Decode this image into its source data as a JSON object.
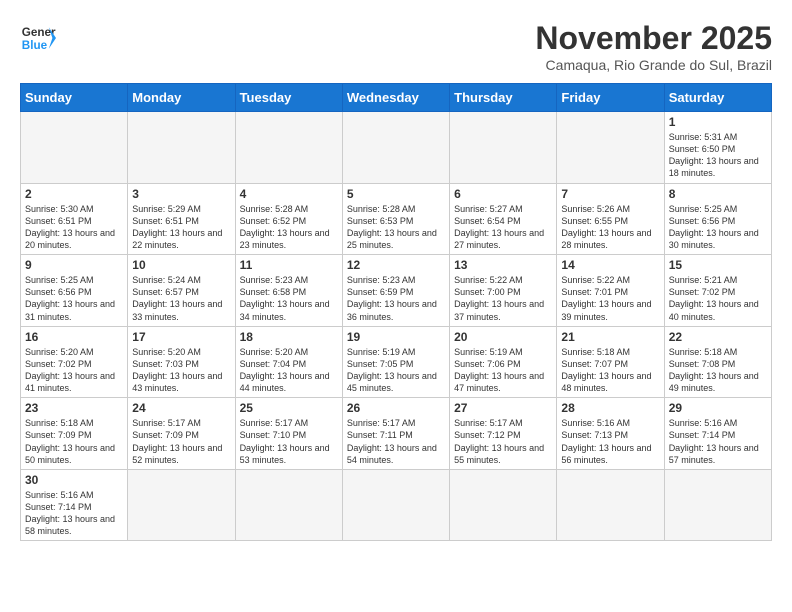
{
  "header": {
    "logo_general": "General",
    "logo_blue": "Blue",
    "month_title": "November 2025",
    "subtitle": "Camaqua, Rio Grande do Sul, Brazil"
  },
  "weekdays": [
    "Sunday",
    "Monday",
    "Tuesday",
    "Wednesday",
    "Thursday",
    "Friday",
    "Saturday"
  ],
  "weeks": [
    [
      {
        "day": "",
        "info": ""
      },
      {
        "day": "",
        "info": ""
      },
      {
        "day": "",
        "info": ""
      },
      {
        "day": "",
        "info": ""
      },
      {
        "day": "",
        "info": ""
      },
      {
        "day": "",
        "info": ""
      },
      {
        "day": "1",
        "info": "Sunrise: 5:31 AM\nSunset: 6:50 PM\nDaylight: 13 hours and 18 minutes."
      }
    ],
    [
      {
        "day": "2",
        "info": "Sunrise: 5:30 AM\nSunset: 6:51 PM\nDaylight: 13 hours and 20 minutes."
      },
      {
        "day": "3",
        "info": "Sunrise: 5:29 AM\nSunset: 6:51 PM\nDaylight: 13 hours and 22 minutes."
      },
      {
        "day": "4",
        "info": "Sunrise: 5:28 AM\nSunset: 6:52 PM\nDaylight: 13 hours and 23 minutes."
      },
      {
        "day": "5",
        "info": "Sunrise: 5:28 AM\nSunset: 6:53 PM\nDaylight: 13 hours and 25 minutes."
      },
      {
        "day": "6",
        "info": "Sunrise: 5:27 AM\nSunset: 6:54 PM\nDaylight: 13 hours and 27 minutes."
      },
      {
        "day": "7",
        "info": "Sunrise: 5:26 AM\nSunset: 6:55 PM\nDaylight: 13 hours and 28 minutes."
      },
      {
        "day": "8",
        "info": "Sunrise: 5:25 AM\nSunset: 6:56 PM\nDaylight: 13 hours and 30 minutes."
      }
    ],
    [
      {
        "day": "9",
        "info": "Sunrise: 5:25 AM\nSunset: 6:56 PM\nDaylight: 13 hours and 31 minutes."
      },
      {
        "day": "10",
        "info": "Sunrise: 5:24 AM\nSunset: 6:57 PM\nDaylight: 13 hours and 33 minutes."
      },
      {
        "day": "11",
        "info": "Sunrise: 5:23 AM\nSunset: 6:58 PM\nDaylight: 13 hours and 34 minutes."
      },
      {
        "day": "12",
        "info": "Sunrise: 5:23 AM\nSunset: 6:59 PM\nDaylight: 13 hours and 36 minutes."
      },
      {
        "day": "13",
        "info": "Sunrise: 5:22 AM\nSunset: 7:00 PM\nDaylight: 13 hours and 37 minutes."
      },
      {
        "day": "14",
        "info": "Sunrise: 5:22 AM\nSunset: 7:01 PM\nDaylight: 13 hours and 39 minutes."
      },
      {
        "day": "15",
        "info": "Sunrise: 5:21 AM\nSunset: 7:02 PM\nDaylight: 13 hours and 40 minutes."
      }
    ],
    [
      {
        "day": "16",
        "info": "Sunrise: 5:20 AM\nSunset: 7:02 PM\nDaylight: 13 hours and 41 minutes."
      },
      {
        "day": "17",
        "info": "Sunrise: 5:20 AM\nSunset: 7:03 PM\nDaylight: 13 hours and 43 minutes."
      },
      {
        "day": "18",
        "info": "Sunrise: 5:20 AM\nSunset: 7:04 PM\nDaylight: 13 hours and 44 minutes."
      },
      {
        "day": "19",
        "info": "Sunrise: 5:19 AM\nSunset: 7:05 PM\nDaylight: 13 hours and 45 minutes."
      },
      {
        "day": "20",
        "info": "Sunrise: 5:19 AM\nSunset: 7:06 PM\nDaylight: 13 hours and 47 minutes."
      },
      {
        "day": "21",
        "info": "Sunrise: 5:18 AM\nSunset: 7:07 PM\nDaylight: 13 hours and 48 minutes."
      },
      {
        "day": "22",
        "info": "Sunrise: 5:18 AM\nSunset: 7:08 PM\nDaylight: 13 hours and 49 minutes."
      }
    ],
    [
      {
        "day": "23",
        "info": "Sunrise: 5:18 AM\nSunset: 7:09 PM\nDaylight: 13 hours and 50 minutes."
      },
      {
        "day": "24",
        "info": "Sunrise: 5:17 AM\nSunset: 7:09 PM\nDaylight: 13 hours and 52 minutes."
      },
      {
        "day": "25",
        "info": "Sunrise: 5:17 AM\nSunset: 7:10 PM\nDaylight: 13 hours and 53 minutes."
      },
      {
        "day": "26",
        "info": "Sunrise: 5:17 AM\nSunset: 7:11 PM\nDaylight: 13 hours and 54 minutes."
      },
      {
        "day": "27",
        "info": "Sunrise: 5:17 AM\nSunset: 7:12 PM\nDaylight: 13 hours and 55 minutes."
      },
      {
        "day": "28",
        "info": "Sunrise: 5:16 AM\nSunset: 7:13 PM\nDaylight: 13 hours and 56 minutes."
      },
      {
        "day": "29",
        "info": "Sunrise: 5:16 AM\nSunset: 7:14 PM\nDaylight: 13 hours and 57 minutes."
      }
    ],
    [
      {
        "day": "30",
        "info": "Sunrise: 5:16 AM\nSunset: 7:14 PM\nDaylight: 13 hours and 58 minutes."
      },
      {
        "day": "",
        "info": ""
      },
      {
        "day": "",
        "info": ""
      },
      {
        "day": "",
        "info": ""
      },
      {
        "day": "",
        "info": ""
      },
      {
        "day": "",
        "info": ""
      },
      {
        "day": "",
        "info": ""
      }
    ]
  ]
}
